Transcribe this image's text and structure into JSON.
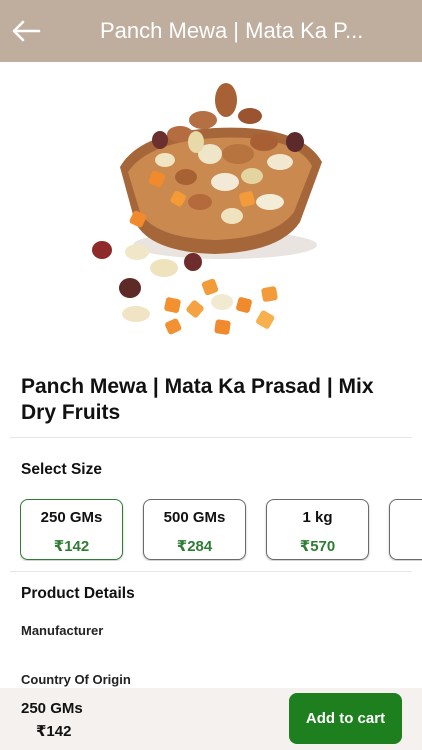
{
  "header": {
    "title": "Panch Mewa | Mata Ka P..."
  },
  "product": {
    "image_alt": "mixed dry fruits in wooden bowl",
    "title": "Panch Mewa | Mata Ka Prasad | Mix Dry Fruits"
  },
  "size_section": {
    "label": "Select Size",
    "options": [
      {
        "name": "250 GMs",
        "price": "₹142",
        "selected": true
      },
      {
        "name": "500 GMs",
        "price": "₹284",
        "selected": false
      },
      {
        "name": "1 kg",
        "price": "₹570",
        "selected": false
      },
      {
        "name": "",
        "price": "",
        "selected": false
      }
    ]
  },
  "details": {
    "heading": "Product Details",
    "manufacturer_label": "Manufacturer",
    "country_label": "Country Of Origin"
  },
  "bottom_bar": {
    "size": "250 GMs",
    "price": "₹142",
    "add_label": "Add to cart"
  },
  "colors": {
    "header_bg": "#bfae9e",
    "accent_green": "#2e7d32",
    "button_green": "#1e7f1e"
  },
  "icons": {
    "back": "arrow-left-icon"
  }
}
